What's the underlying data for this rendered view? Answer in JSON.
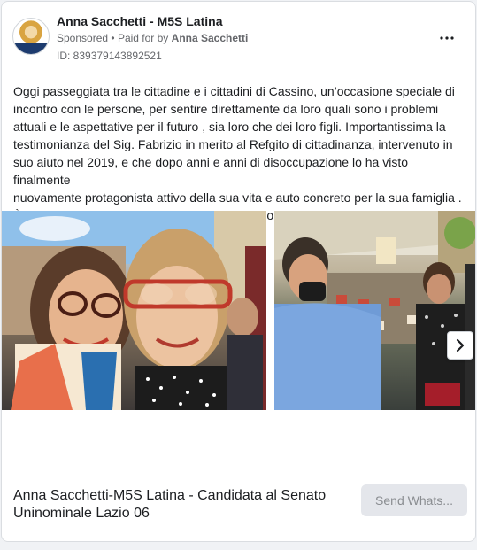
{
  "ad": {
    "page_name": "Anna Sacchetti - M5S Latina",
    "sponsored_label": "Sponsored",
    "separator": "•",
    "paid_for_prefix": "Paid for by",
    "paid_for_name": "Anna Sacchetti",
    "library_id": "ID: 839379143892521",
    "more_icon": "more-horizontal-icon"
  },
  "post": {
    "lines": [
      "Oggi passeggiata tra le cittadine e i cittadini di Cassino, un’occasione speciale di",
      "incontro con le persone, per sentire direttamente da loro quali sono i problemi",
      "attuali e le aspettative per il futuro , sia loro che dei loro figli. Importantissima la",
      "testimonianza del Sig. Fabrizio in merito al Refgito di cittadinanza, intervenuto in",
      "suo aiuto nel 2019, e che dopo anni e anni di disoccupazione lo ha visto finalmente",
      "nuovamente protagonista attivo della sua vita e auto concreto per la sua famiglia .",
      "È bene ricordare infatti che la disoccupazione o un momento di difficoltà può..."
    ]
  },
  "carousel": {
    "next_icon": "chevron-right-icon"
  },
  "cta": {
    "headline_line1": "Anna Sacchetti-M5S Latina - Candidata al Senato",
    "headline_line2": "Uninominale Lazio 06",
    "button_label": "Send Whats..."
  },
  "colors": {
    "brand_navy": "#1d3b6e",
    "secondary_text": "#65676b",
    "button_bg": "#e4e6eb",
    "button_text": "#8a8d91"
  }
}
